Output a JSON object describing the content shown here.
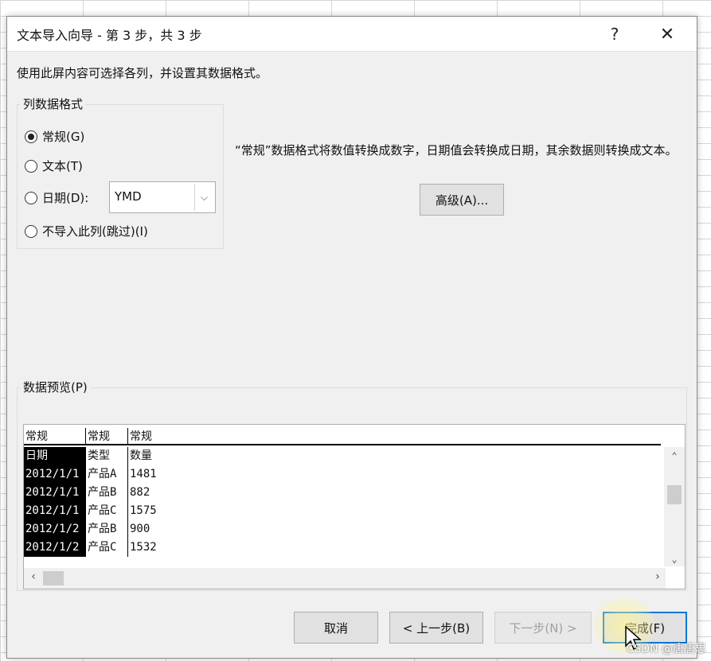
{
  "dialog": {
    "title": "文本导入向导 - 第 3 步，共 3 步",
    "help": "?",
    "close": "✕",
    "instruction": "使用此屏内容可选择各列，并设置其数据格式。"
  },
  "column_format": {
    "legend": "列数据格式",
    "options": [
      {
        "label": "常规(G)",
        "selected": true
      },
      {
        "label": "文本(T)",
        "selected": false
      },
      {
        "label": "日期(D):",
        "selected": false
      },
      {
        "label": "不导入此列(跳过)(I)",
        "selected": false
      }
    ],
    "date_format": "YMD"
  },
  "description": "“常规”数据格式将数值转换成数字，日期值会转换成日期，其余数据则转换成文本。",
  "advanced_button": "高级(A)...",
  "preview": {
    "legend": "数据预览(P)",
    "headers": [
      "常规",
      "常规",
      "常规"
    ],
    "rows": [
      [
        "日期",
        "类型",
        "数量"
      ],
      [
        "2012/1/1",
        "产品A",
        "1481"
      ],
      [
        "2012/1/1",
        "产品B",
        "882"
      ],
      [
        "2012/1/1",
        "产品C",
        "1575"
      ],
      [
        "2012/1/2",
        "产品B",
        "900"
      ],
      [
        "2012/1/2",
        "产品C",
        "1532"
      ]
    ]
  },
  "buttons": {
    "cancel": "取消",
    "back": "< 上一步(B)",
    "next": "下一步(N) >",
    "finish": "完成(F)"
  },
  "watermark": "CSDN @唐唐思"
}
